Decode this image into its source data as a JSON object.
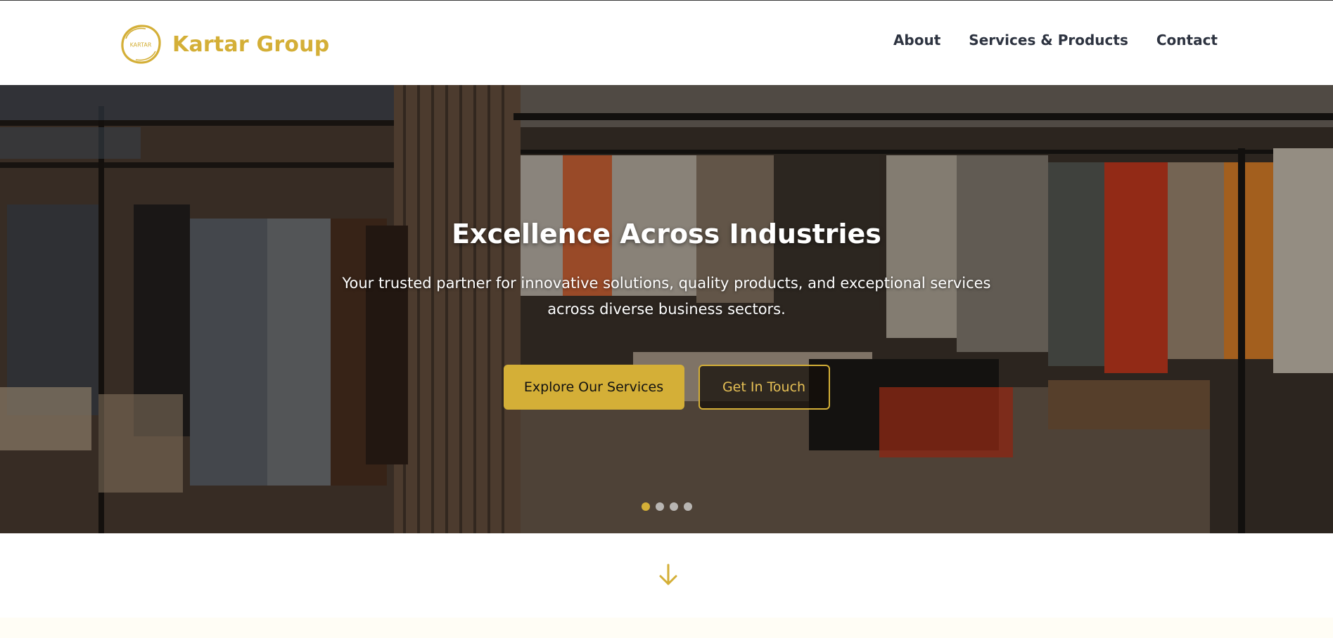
{
  "brand": {
    "logo_text": "KARTAR",
    "name": "Kartar Group",
    "accent_color": "#d4af37"
  },
  "nav": {
    "items": [
      {
        "label": "About"
      },
      {
        "label": "Services & Products"
      },
      {
        "label": "Contact"
      }
    ]
  },
  "hero": {
    "title": "Excellence Across Industries",
    "subtitle": "Your trusted partner for innovative solutions, quality products, and exceptional services across diverse business sectors.",
    "primary_button": "Explore Our Services",
    "secondary_button": "Get In Touch",
    "slides_total": 4,
    "active_slide": 1
  },
  "icons": {
    "scroll": "arrow-down-icon",
    "logo": "kartar-logo-icon"
  }
}
